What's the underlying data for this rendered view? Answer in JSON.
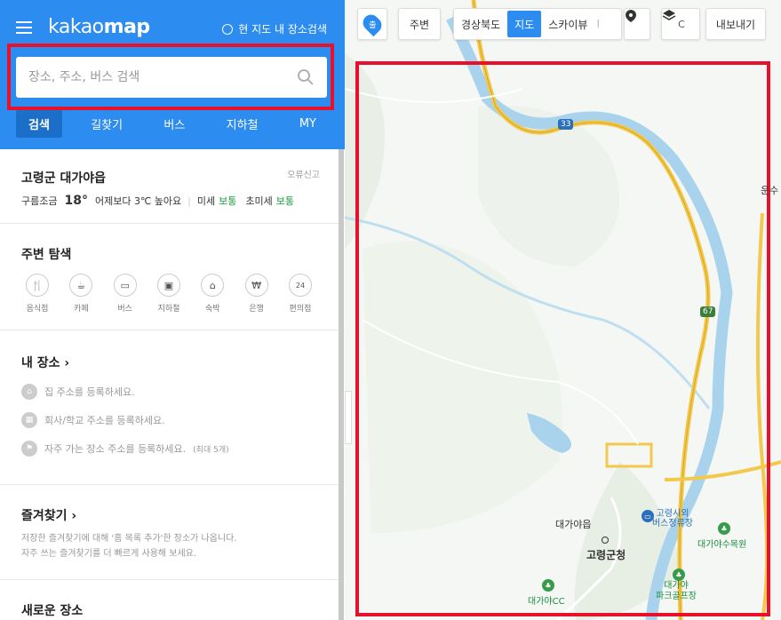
{
  "app": {
    "logo_regular": "kakao",
    "logo_bold": "map",
    "scope_search": "현 지도 내 장소검색"
  },
  "search": {
    "placeholder": "장소, 주소, 버스 검색"
  },
  "tabs": [
    {
      "label": "검색"
    },
    {
      "label": "길찾기"
    },
    {
      "label": "버스"
    },
    {
      "label": "지하철"
    },
    {
      "label": "MY"
    }
  ],
  "weather": {
    "place": "고령군 대가야읍",
    "report": "오류신고",
    "condition": "구름조금",
    "temp": "18°",
    "compare": "어제보다 3℃ 높아요",
    "dust_label": "미세",
    "dust_value": "보통",
    "ultra_label": "초미세",
    "ultra_value": "보통"
  },
  "around": {
    "title": "주변 탐색",
    "items": [
      {
        "label": "음식점",
        "icon": "fork-knife-icon"
      },
      {
        "label": "카페",
        "icon": "cup-icon"
      },
      {
        "label": "버스",
        "icon": "bus-icon"
      },
      {
        "label": "지하철",
        "icon": "subway-icon"
      },
      {
        "label": "숙박",
        "icon": "bed-icon"
      },
      {
        "label": "은행",
        "icon": "won-icon"
      },
      {
        "label": "편의점",
        "icon": "store-24-icon"
      }
    ]
  },
  "my_place": {
    "title": "내 장소",
    "home": "집 주소를 등록하세요.",
    "work": "회사/학교 주소를 등록하세요.",
    "frequent": "자주 가는 장소 주소를 등록하세요.",
    "frequent_note": "(최대 5개)"
  },
  "favorites": {
    "title": "즐겨찾기",
    "desc1": "저장한 즐겨찾기에 대해 '홈 목록 추가'한 장소가 나옵니다.",
    "desc2": "자주 쓰는 즐겨찾기를 더 빠르게 사용해 보세요."
  },
  "new_place": {
    "title": "새로운 장소"
  },
  "map": {
    "toolbar": {
      "start_label": "출",
      "nearby": "주변",
      "region": "경상북도",
      "map_mode": "지도",
      "skyview": "스카이뷰",
      "skyview_suffix": "I",
      "skyview_cut": "C",
      "export": "내보내기"
    },
    "labels": {
      "town": "대가야읍",
      "county_office": "고령군청",
      "bus_terminal_1": "고령시외",
      "bus_terminal_2": "버스정류장",
      "arboretum": "대가야수목원",
      "cc": "대가야CC",
      "golf_1": "대가야",
      "golf_2": "파크골프장",
      "edge": "운수"
    },
    "shields": {
      "route_33": "33",
      "route_67": "67"
    },
    "colors": {
      "river": "#a9d3ec",
      "highway": "#f2c94c",
      "road": "#ffffff",
      "outline": "#e8102a",
      "accent": "#2d8cf0"
    }
  }
}
